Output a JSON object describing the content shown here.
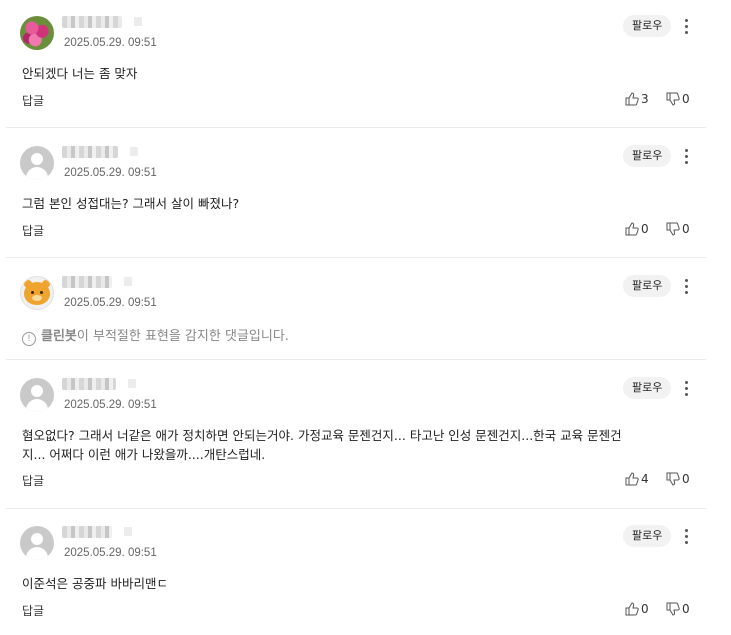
{
  "comments": [
    {
      "timestamp": "2025.05.29. 09:51",
      "follow": "팔로우",
      "text": "안되겠다 너는 좀 맞자",
      "reply": "답글",
      "likes": "3",
      "dislikes": "0"
    },
    {
      "timestamp": "2025.05.29. 09:51",
      "follow": "팔로우",
      "text": "그럼 본인 성접대는? 그래서 살이 빠졌나?",
      "reply": "답글",
      "likes": "0",
      "dislikes": "0"
    },
    {
      "timestamp": "2025.05.29. 09:51",
      "follow": "팔로우",
      "cleanbot_name": "클린봇",
      "cleanbot_rest": "이 부적절한 표현을 감지한 댓글입니다."
    },
    {
      "timestamp": "2025.05.29. 09:51",
      "follow": "팔로우",
      "text_line1": "혐오없다? 그래서 너같은 애가 정치하면 안되는거야. 가정교육 문젠건지... 타고난 인성 문젠건지...한국 교육 문젠건",
      "text_line2": "지... 어쩌다 이런 애가 나왔을까....개탄스럽네.",
      "reply": "답글",
      "likes": "4",
      "dislikes": "0"
    },
    {
      "timestamp": "2025.05.29. 09:51",
      "follow": "팔로우",
      "text": "이준석은 공중파 바바리맨ㄷ",
      "reply": "답글",
      "likes": "0",
      "dislikes": "0"
    }
  ]
}
